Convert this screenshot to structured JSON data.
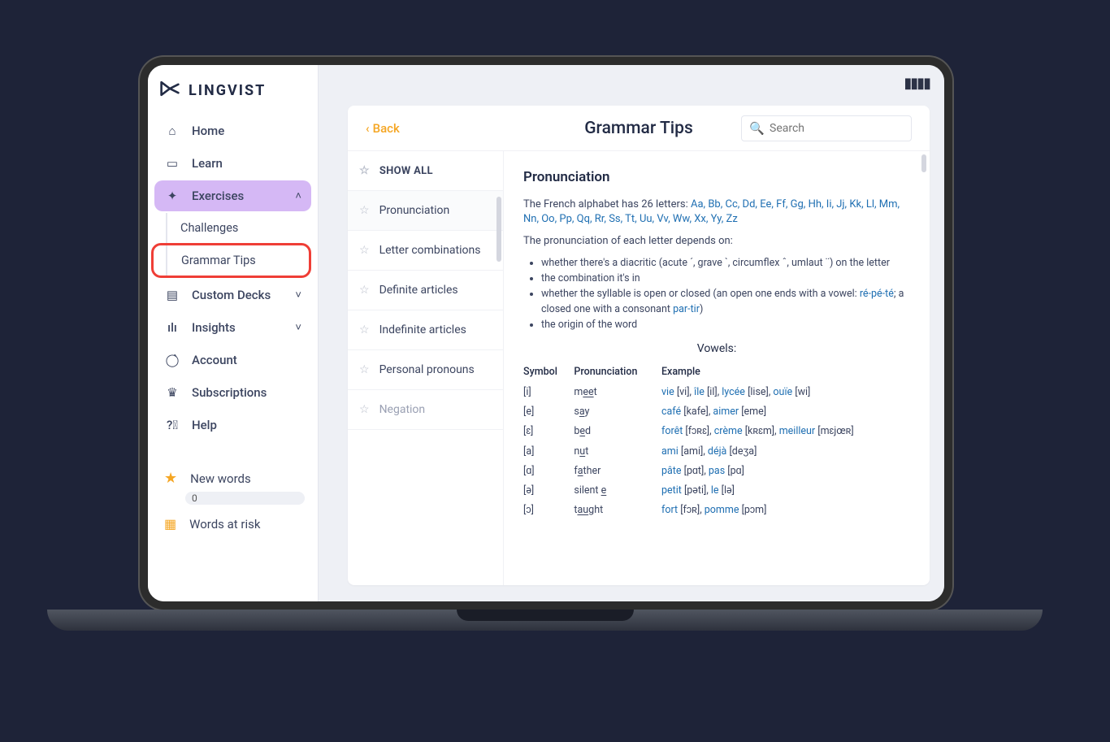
{
  "brand": "LINGVIST",
  "sidebar": {
    "home": "Home",
    "learn": "Learn",
    "exercises": "Exercises",
    "challenges": "Challenges",
    "grammar_tips": "Grammar Tips",
    "custom_decks": "Custom Decks",
    "insights": "Insights",
    "account": "Account",
    "subscriptions": "Subscriptions",
    "help": "Help",
    "new_words": "New words",
    "new_words_count": "0",
    "words_at_risk": "Words at risk"
  },
  "header": {
    "back": "Back",
    "title": "Grammar Tips",
    "search_placeholder": "Search"
  },
  "topics": {
    "show_all": "SHOW ALL",
    "items": [
      "Pronunciation",
      "Letter combinations",
      "Definite articles",
      "Indefinite articles",
      "Personal pronouns",
      "Negation"
    ]
  },
  "article": {
    "heading": "Pronunciation",
    "intro_prefix": "The French alphabet has 26 letters: ",
    "letters": "Aa, Bb, Cc, Dd, Ee, Ff, Gg, Hh, Ii, Jj, Kk, Ll, Mm, Nn, Oo, Pp, Qq, Rr, Ss, Tt, Uu, Vv, Ww, Xx, Yy, Zz",
    "depends_line": "The pronunciation of each letter depends on:",
    "bullets": {
      "b1": "whether there's a diacritic (acute ´, grave `, circumflex ˆ, umlaut ¨) on the letter",
      "b2": "the combination it's in",
      "b3_pre": "whether the syllable is open or closed (an open one ends with a vowel: ",
      "b3_link1": "ré-pé-té",
      "b3_mid": "; a closed one with a consonant ",
      "b3_link2": "par-tir",
      "b3_suf": ")",
      "b4": "the origin of the word"
    },
    "vowels_title": "Vowels:",
    "table": {
      "h1": "Symbol",
      "h2": "Pronunciation",
      "h3": "Example",
      "rows": [
        {
          "sym": "[i]",
          "pre": "m",
          "u": "ee",
          "post": "t",
          "ex": "<span class='ex'>vie</span> <span class='ipa'>[vi]</span>, <span class='ex'>île</span> <span class='ipa'>[il]</span>, <span class='ex'>lycée</span> <span class='ipa'>[lise]</span>, <span class='ex'>ouïe</span> <span class='ipa'>[wi]</span>"
        },
        {
          "sym": "[e]",
          "pre": "s",
          "u": "a",
          "post": "y",
          "ex": "<span class='ex'>café</span> <span class='ipa'>[kafe]</span>, <span class='ex'>aimer</span> <span class='ipa'>[eme]</span>"
        },
        {
          "sym": "[ɛ]",
          "pre": "b",
          "u": "e",
          "post": "d",
          "ex": "<span class='ex'>forêt</span> <span class='ipa'>[fɔʀɛ]</span>, <span class='ex'>crème</span> <span class='ipa'>[kʀɛm]</span>, <span class='ex'>meilleur</span> <span class='ipa'>[mɛjœʀ]</span>"
        },
        {
          "sym": "[a]",
          "pre": "n",
          "u": "u",
          "post": "t",
          "ex": "<span class='ex'>ami</span> <span class='ipa'>[ami]</span>, <span class='ex'>déjà</span> <span class='ipa'>[deʒa]</span>"
        },
        {
          "sym": "[ɑ]",
          "pre": "f",
          "u": "a",
          "post": "ther",
          "ex": "<span class='ex'>pâte</span> <span class='ipa'>[pɑt]</span>, <span class='ex'>pas</span> <span class='ipa'>[pɑ]</span>"
        },
        {
          "sym": "[ə]",
          "pre": "silent ",
          "u": "e",
          "post": "",
          "ex": "<span class='ex'>petit</span> <span class='ipa'>[pəti]</span>, <span class='ex'>le</span> <span class='ipa'>[lə]</span>"
        },
        {
          "sym": "[ɔ]",
          "pre": "t",
          "u": "au",
          "post": "ght",
          "ex": "<span class='ex'>fort</span> <span class='ipa'>[fɔʀ]</span>, <span class='ex'>pomme</span> <span class='ipa'>[pɔm]</span>"
        }
      ]
    }
  }
}
